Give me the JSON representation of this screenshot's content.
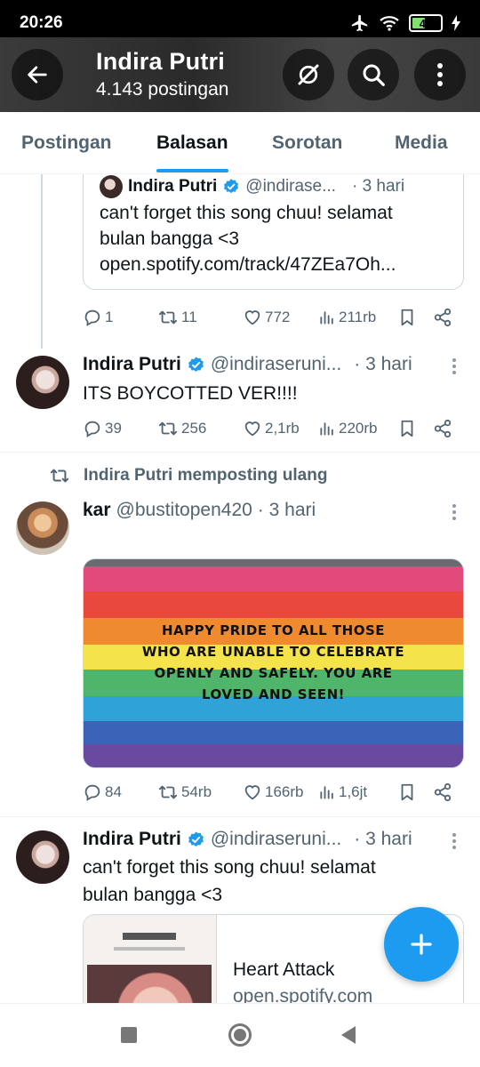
{
  "status_bar": {
    "time": "20:26",
    "battery": "42"
  },
  "header": {
    "name": "Indira Putri",
    "post_count": "4.143 postingan"
  },
  "tabs": [
    {
      "label": "Postingan",
      "active": false
    },
    {
      "label": "Balasan",
      "active": true
    },
    {
      "label": "Sorotan",
      "active": false
    },
    {
      "label": "Media",
      "active": false
    }
  ],
  "quote_tweet": {
    "name": "Indira Putri",
    "handle": "@indirase...",
    "time": "· 3 hari",
    "line1": "can't forget this song chuu! selamat",
    "line2": "bulan bangga <3",
    "line3": "open.spotify.com/track/47ZEa7Oh..."
  },
  "tweets": [
    {
      "actions": {
        "replies": "1",
        "retweets": "11",
        "likes": "772",
        "views": "211rb"
      }
    },
    {
      "name": "Indira Putri",
      "handle": "@indiraseruni...",
      "time": "· 3 hari",
      "text": "ITS BOYCOTTED VER!!!!",
      "actions": {
        "replies": "39",
        "retweets": "256",
        "likes": "2,1rb",
        "views": "220rb"
      }
    },
    {
      "retweet_label": "Indira Putri memposting ulang",
      "name": "kar",
      "handle": "@bustitopen420",
      "time": "· 3 hari",
      "image_text": {
        "line1": "HAPPY PRIDE TO ALL THOSE",
        "line2": "WHO ARE UNABLE TO CELEBRATE",
        "line3": "OPENLY AND SAFELY. YOU ARE",
        "line4": "LOVED AND SEEN!"
      },
      "actions": {
        "replies": "84",
        "retweets": "54rb",
        "likes": "166rb",
        "views": "1,6jt"
      }
    },
    {
      "name": "Indira Putri",
      "handle": "@indiraseruni...",
      "time": "· 3 hari",
      "line1": "can't forget this song chuu! selamat",
      "line2": "bulan bangga <3",
      "link_title": "Heart Attack",
      "link_domain": "open.spotify.com"
    }
  ],
  "colors": {
    "accent": "#1d9bf0",
    "muted": "#536471",
    "border": "#cfd9de"
  }
}
